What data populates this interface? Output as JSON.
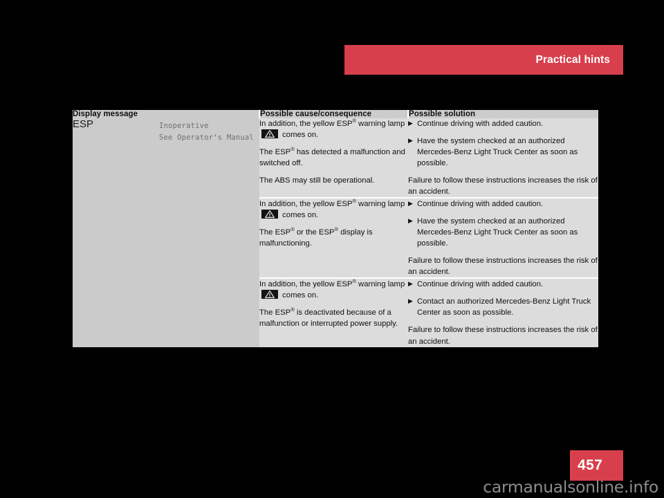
{
  "header": {
    "title": "Practical hints",
    "accent_color": "#d83f4c"
  },
  "page": {
    "number": "457",
    "badge_color": "#d83f4c",
    "background_color": "#000000"
  },
  "watermark": {
    "text": "carmanualsonline.info"
  },
  "table": {
    "columns": [
      {
        "key": "display_message",
        "label": "Display message"
      },
      {
        "key": "possible_cause",
        "label": "Possible cause/consequence"
      },
      {
        "key": "possible_solution",
        "label": "Possible solution"
      }
    ],
    "display_message": {
      "code": "ESP",
      "screen_lines": "Inoperative\nSee Operator‘s Manual"
    },
    "rows": [
      {
        "cause": {
          "p1_before_icon": "In addition, the yellow ESP",
          "p1_reg": "®",
          "p1_mid": " warning lamp ",
          "p1_icon": "warning-triangle-lamp-icon",
          "p1_after_icon": " comes on.",
          "p2_before_reg": "The ESP",
          "p2_reg": "®",
          "p2_after_reg": " has detected a malfunc­tion and switched off.",
          "p3": "The ABS may still be operational."
        },
        "solution": {
          "bullets": [
            "Continue driving with added caution.",
            "Have the system checked at an authorized Mercedes-Benz Light Truck Center as soon as possible."
          ],
          "note": "Failure to follow these instructions increases the risk of an accident."
        }
      },
      {
        "cause": {
          "p1_before_icon": "In addition, the yellow ESP",
          "p1_reg": "®",
          "p1_mid": " warning lamp ",
          "p1_icon": "warning-triangle-lamp-icon",
          "p1_after_icon": " comes on.",
          "p2_before_reg": "The ESP",
          "p2_reg": "®",
          "p2_mid": " or the ESP",
          "p2_reg2": "®",
          "p2_after_reg": " display is malfunctioning."
        },
        "solution": {
          "bullets": [
            "Continue driving with added caution.",
            "Have the system checked at an authorized Mercedes-Benz Light Truck Center as soon as possible."
          ],
          "note": "Failure to follow these instructions increases the risk of an accident."
        }
      },
      {
        "cause": {
          "p1_before_icon": "In addition, the yellow ESP",
          "p1_reg": "®",
          "p1_mid": " warning lamp ",
          "p1_icon": "warning-triangle-lamp-icon",
          "p1_after_icon": " comes on.",
          "p2_before_reg": "The ESP",
          "p2_reg": "®",
          "p2_after_reg": " is deactivated because of a malfunction or interrupted power supply."
        },
        "solution": {
          "bullets": [
            "Continue driving with added caution.",
            "Contact an authorized Mercedes-Benz Light Truck Center as soon as possible."
          ],
          "note": "Failure to follow these instructions increases the risk of an accident."
        }
      }
    ]
  },
  "icons": {
    "bullet_marker": "▶",
    "warning_lamp": "warning-triangle-lamp-icon"
  }
}
